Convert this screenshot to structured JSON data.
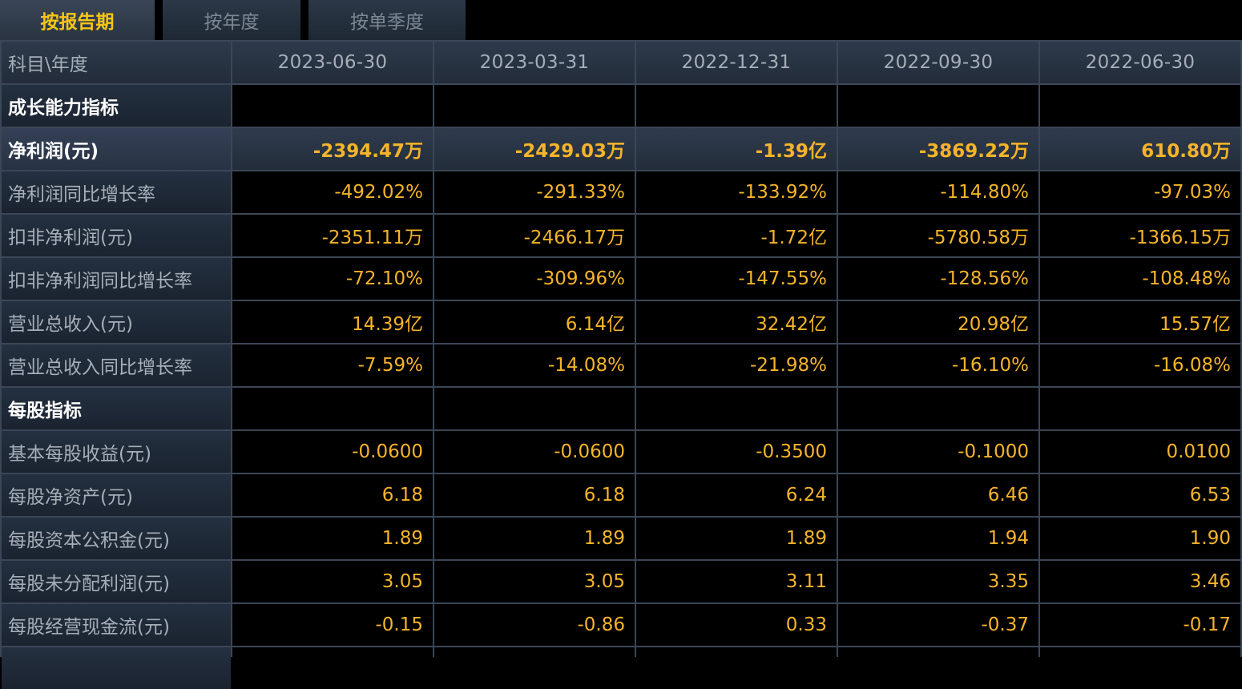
{
  "tabs": [
    {
      "label": "按报告期",
      "active": true
    },
    {
      "label": "按年度",
      "active": false
    },
    {
      "label": "按单季度",
      "active": false
    }
  ],
  "header": {
    "corner": "科目\\年度",
    "periods": [
      "2023-06-30",
      "2023-03-31",
      "2022-12-31",
      "2022-09-30",
      "2022-06-30"
    ]
  },
  "rows": [
    {
      "type": "section",
      "label": "成长能力指标"
    },
    {
      "type": "highlight",
      "label": "净利润(元)",
      "values": [
        "-2394.47万",
        "-2429.03万",
        "-1.39亿",
        "-3869.22万",
        "610.80万"
      ]
    },
    {
      "type": "data",
      "label": "净利润同比增长率",
      "values": [
        "-492.02%",
        "-291.33%",
        "-133.92%",
        "-114.80%",
        "-97.03%"
      ]
    },
    {
      "type": "data",
      "label": "扣非净利润(元)",
      "values": [
        "-2351.11万",
        "-2466.17万",
        "-1.72亿",
        "-5780.58万",
        "-1366.15万"
      ]
    },
    {
      "type": "data",
      "label": "扣非净利润同比增长率",
      "values": [
        "-72.10%",
        "-309.96%",
        "-147.55%",
        "-128.56%",
        "-108.48%"
      ]
    },
    {
      "type": "data",
      "label": "营业总收入(元)",
      "values": [
        "14.39亿",
        "6.14亿",
        "32.42亿",
        "20.98亿",
        "15.57亿"
      ]
    },
    {
      "type": "data",
      "label": "营业总收入同比增长率",
      "values": [
        "-7.59%",
        "-14.08%",
        "-21.98%",
        "-16.10%",
        "-16.08%"
      ]
    },
    {
      "type": "section",
      "label": "每股指标"
    },
    {
      "type": "data",
      "label": "基本每股收益(元)",
      "values": [
        "-0.0600",
        "-0.0600",
        "-0.3500",
        "-0.1000",
        "0.0100"
      ]
    },
    {
      "type": "data",
      "label": "每股净资产(元)",
      "values": [
        "6.18",
        "6.18",
        "6.24",
        "6.46",
        "6.53"
      ]
    },
    {
      "type": "data",
      "label": "每股资本公积金(元)",
      "values": [
        "1.89",
        "1.89",
        "1.89",
        "1.94",
        "1.90"
      ]
    },
    {
      "type": "data",
      "label": "每股未分配利润(元)",
      "values": [
        "3.05",
        "3.05",
        "3.11",
        "3.35",
        "3.46"
      ]
    },
    {
      "type": "data",
      "label": "每股经营现金流(元)",
      "values": [
        "-0.15",
        "-0.86",
        "0.33",
        "-0.37",
        "-0.17"
      ]
    }
  ],
  "colors": {
    "accent_tab": "#f5c518",
    "value": "#f5b42a",
    "grid_line": "#3b4656",
    "background": "#000000"
  }
}
